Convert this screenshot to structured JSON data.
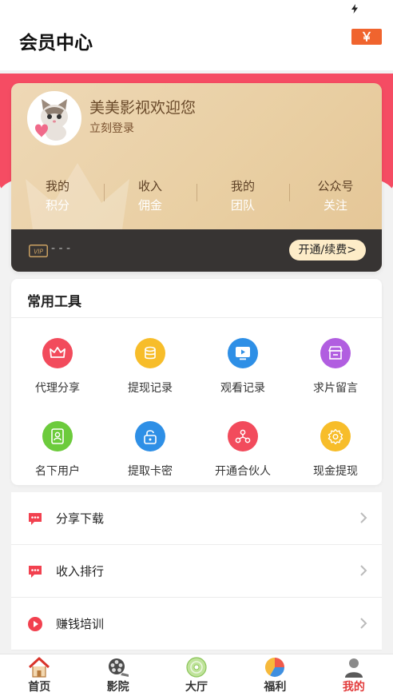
{
  "header": {
    "title": "会员中心",
    "wallet_label": "￥"
  },
  "profile": {
    "welcome": "美美影视欢迎您",
    "login_text": "立刻登录"
  },
  "stats": [
    {
      "top": "我的",
      "bottom": "积分"
    },
    {
      "top": "收入",
      "bottom": "佣金"
    },
    {
      "top": "我的",
      "bottom": "团队"
    },
    {
      "top": "公众号",
      "bottom": "关注"
    }
  ],
  "vip": {
    "status": "- - -",
    "renew_label": "开通/续费>"
  },
  "tools": {
    "title": "常用工具",
    "items": [
      {
        "label": "代理分享",
        "icon": "crown-icon",
        "color": "#f24b5c"
      },
      {
        "label": "提现记录",
        "icon": "coins-icon",
        "color": "#f7bd2a"
      },
      {
        "label": "观看记录",
        "icon": "play-screen-icon",
        "color": "#2e8fe6"
      },
      {
        "label": "求片留言",
        "icon": "store-icon",
        "color": "#b15ee0"
      },
      {
        "label": "名下用户",
        "icon": "user-card-icon",
        "color": "#6ccb3c"
      },
      {
        "label": "提取卡密",
        "icon": "lock-icon",
        "color": "#2e8fe6"
      },
      {
        "label": "开通合伙人",
        "icon": "network-icon",
        "color": "#f24b5c"
      },
      {
        "label": "现金提现",
        "icon": "gear-icon",
        "color": "#f7bd2a"
      }
    ]
  },
  "menu": [
    {
      "label": "分享下载",
      "icon": "chat-dots-icon"
    },
    {
      "label": "收入排行",
      "icon": "chat-dots-icon"
    },
    {
      "label": "赚钱培训",
      "icon": "play-circle-icon"
    }
  ],
  "tabs": [
    {
      "label": "首页",
      "icon": "home-icon"
    },
    {
      "label": "影院",
      "icon": "film-reel-icon"
    },
    {
      "label": "大厅",
      "icon": "disc-icon"
    },
    {
      "label": "福利",
      "icon": "pie-chart-icon"
    },
    {
      "label": "我的",
      "icon": "user-icon",
      "active": true
    }
  ],
  "colors": {
    "accent_red": "#f54c63",
    "card_gold": "#e9cfa3",
    "vip_bar": "#373433",
    "renew_button": "#fdecc8",
    "active_tab": "#e23a3a"
  }
}
